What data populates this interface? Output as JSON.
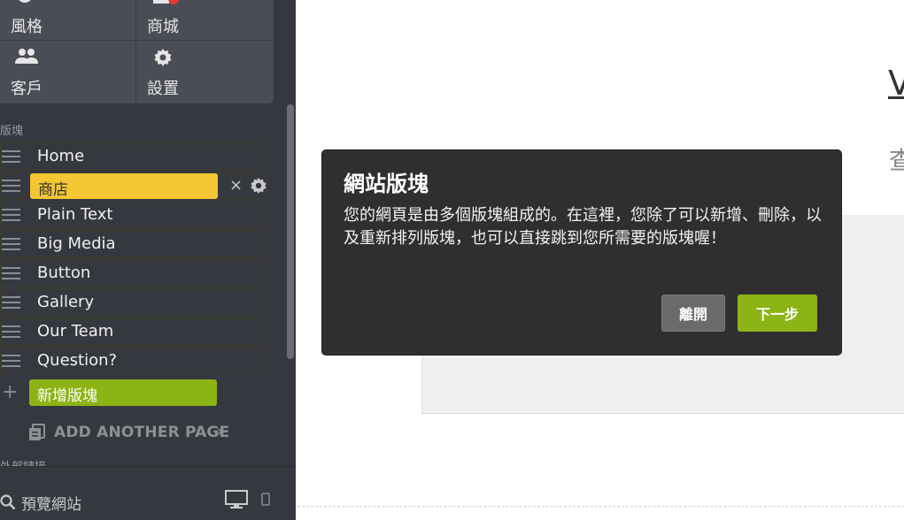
{
  "nav": {
    "items": [
      {
        "label": "風格",
        "icon": "palette-icon"
      },
      {
        "label": "商城",
        "icon": "store-icon",
        "badge_color": "#e53935"
      },
      {
        "label": "客戶",
        "icon": "people-icon"
      },
      {
        "label": "設置",
        "icon": "gear-icon"
      }
    ]
  },
  "sidebar": {
    "section_label": "版塊",
    "blocks": [
      {
        "label": "Home"
      },
      {
        "label": "商店",
        "active": true
      },
      {
        "label": "Plain Text"
      },
      {
        "label": "Big Media"
      },
      {
        "label": "Button"
      },
      {
        "label": "Gallery"
      },
      {
        "label": "Our Team"
      },
      {
        "label": "Question?"
      }
    ],
    "add_block_label": "新增版塊",
    "add_page_label": "ADD ANOTHER PAGE",
    "add_page_chevron": "›",
    "close_glyph": "×",
    "cutoff_section_label": "外部鏈接",
    "preview_label": "預覽網站"
  },
  "tooltip": {
    "title": "網站版塊",
    "body": "您的網頁是由多個版塊組成的。在這裡，您除了可以新增、刪除，以及重新排列版塊，也可以直接跳到您所需要的版塊喔！",
    "close_label": "離開",
    "next_label": "下一步"
  },
  "main": {
    "heading_fragment": "V",
    "subheading_fragment": "查"
  },
  "colors": {
    "sidebar_bg": "#35383f",
    "active_block": "#f5c633",
    "accent_green": "#8cb415",
    "tooltip_bg": "#2f2f31"
  }
}
